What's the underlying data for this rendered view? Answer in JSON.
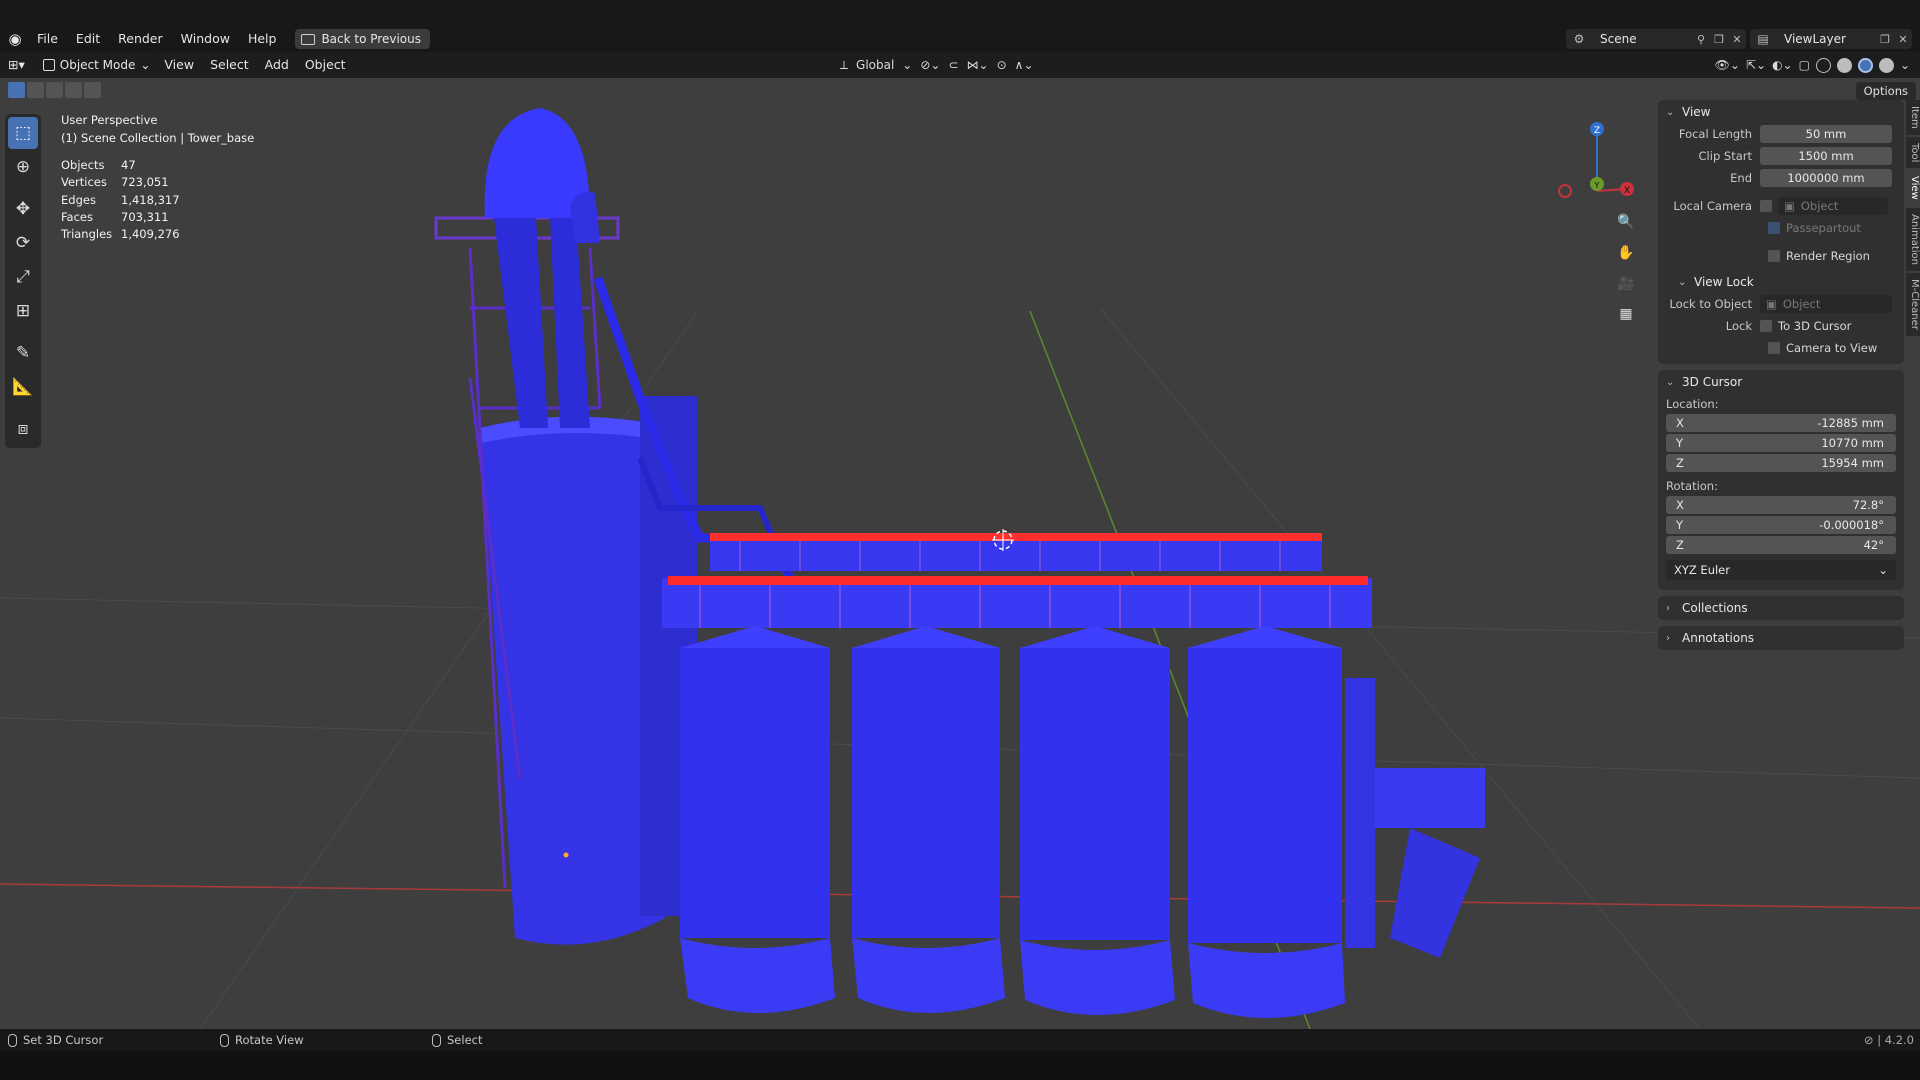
{
  "menubar": {
    "items": [
      "File",
      "Edit",
      "Render",
      "Window",
      "Help"
    ],
    "back_label": "Back to Previous",
    "scene": "Scene",
    "view_layer": "ViewLayer"
  },
  "viewport_header": {
    "mode": "Object Mode",
    "menus": [
      "View",
      "Select",
      "Add",
      "Object"
    ],
    "orientation": "Global",
    "options": "Options"
  },
  "overlay": {
    "perspective": "User Perspective",
    "collection": "(1) Scene Collection | Tower_base",
    "stats": [
      {
        "label": "Objects",
        "value": "47"
      },
      {
        "label": "Vertices",
        "value": "723,051"
      },
      {
        "label": "Edges",
        "value": "1,418,317"
      },
      {
        "label": "Faces",
        "value": "703,311"
      },
      {
        "label": "Triangles",
        "value": "1,409,276"
      }
    ]
  },
  "gizmo": {
    "x": "X",
    "y": "Y",
    "z": "Z"
  },
  "npanel": {
    "view": {
      "title": "View",
      "focal_length_label": "Focal Length",
      "focal_length": "50 mm",
      "clip_start_label": "Clip Start",
      "clip_start": "1500 mm",
      "clip_end_label": "End",
      "clip_end": "1000000 mm",
      "local_camera_label": "Local Camera",
      "local_camera_placeholder": "Object",
      "passepartout": "Passepartout",
      "render_region": "Render Region"
    },
    "view_lock": {
      "title": "View Lock",
      "lock_to_object_label": "Lock to Object",
      "lock_to_object_placeholder": "Object",
      "lock_label": "Lock",
      "to_cursor": "To 3D Cursor",
      "camera_to_view": "Camera to View"
    },
    "cursor": {
      "title": "3D Cursor",
      "location_label": "Location:",
      "location": [
        {
          "axis": "X",
          "value": "-12885 mm"
        },
        {
          "axis": "Y",
          "value": "10770 mm"
        },
        {
          "axis": "Z",
          "value": "15954 mm"
        }
      ],
      "rotation_label": "Rotation:",
      "rotation": [
        {
          "axis": "X",
          "value": "72.8°"
        },
        {
          "axis": "Y",
          "value": "-0.000018°"
        },
        {
          "axis": "Z",
          "value": "42°"
        }
      ],
      "rotation_mode": "XYZ Euler"
    },
    "collections": "Collections",
    "annotations": "Annotations",
    "tabs": [
      "Item",
      "Tool",
      "View",
      "Animation",
      "M-Cleaner"
    ]
  },
  "statusbar": {
    "left": "Set 3D Cursor",
    "middle": "Rotate View",
    "right": "Select",
    "version": "4.2.0"
  },
  "colors": {
    "accent": "#4772b3",
    "model_blue": "#3a3aff",
    "model_red": "#ff2a2a",
    "axis_x": "#c8323c",
    "axis_y": "#6a9a2a"
  }
}
